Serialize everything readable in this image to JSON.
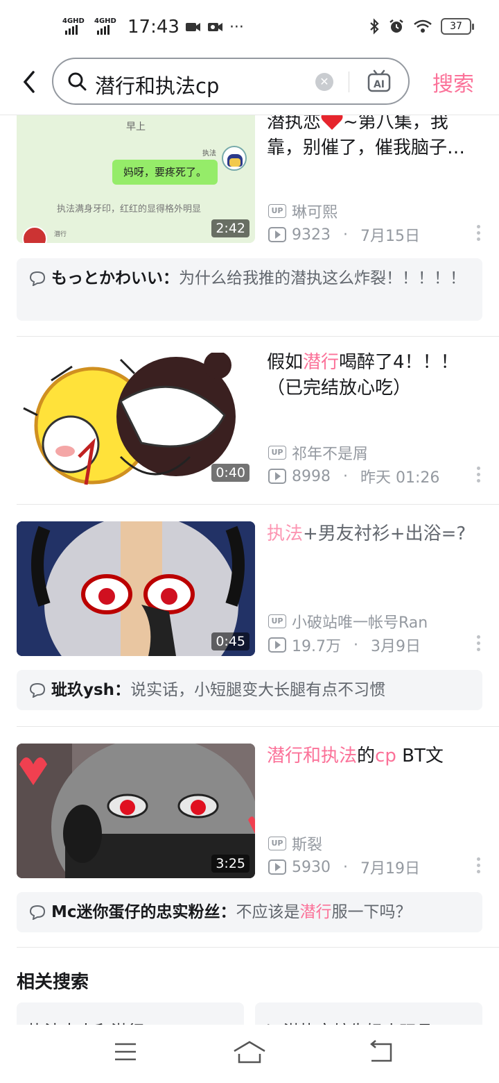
{
  "status_bar": {
    "signal_1_label": "4GHD",
    "signal_2_label": "4GHD",
    "time": "17:43",
    "more": "···",
    "battery": "37"
  },
  "search": {
    "query": "潜行和执法cp",
    "clear_icon": "clear-icon",
    "ai_label": "AI",
    "button_label": "搜索"
  },
  "accent_color": "#fb7299",
  "results": [
    {
      "title_parts": [
        "潜执恋",
        "~第八集，我靠，别催了，催我脑子…"
      ],
      "thumb_texts": [
        "早上",
        "执法",
        "妈呀，要疼死了。",
        "执法满身牙印，红红的显得格外明显",
        "潜行"
      ],
      "duration": "2:42",
      "uploader": "琳可熙",
      "views": "9323",
      "date": "7月15日",
      "comment_user": "もっとかわいい",
      "comment_text": "为什么给我推的潜执这么炸裂！！！！！"
    },
    {
      "title_pre": "假如",
      "title_hl": "潜行",
      "title_post": "喝醉了4！！！（已完结放心吃）",
      "duration": "0:40",
      "uploader": "祁年不是屑",
      "views": "8998",
      "date": "昨天 01:26"
    },
    {
      "title_hl": "执法",
      "title_post": "+男友衬衫+出浴=?",
      "duration": "0:45",
      "uploader": "小破站唯一帐号Ran",
      "views": "19.7万",
      "date": "3月9日",
      "comment_user": "玼玖ysh",
      "comment_text": "说实话，小短腿变大长腿有点不习惯"
    },
    {
      "title_hl1": "潜行和执法",
      "title_mid": "的",
      "title_hl2": "cp",
      "title_post": " BT文",
      "duration": "3:25",
      "uploader": "斯裂",
      "views": "5930",
      "date": "7月19日",
      "comment_user": "Mc迷你蛋仔的忠实粉丝",
      "comment_pre": "不应该是",
      "comment_hl": "潜行",
      "comment_post": "服一下吗？"
    }
  ],
  "related": {
    "title": "相关搜索",
    "items": [
      "执法大人和潜行",
      "bt潜执文较失妈小玩具"
    ]
  },
  "colon": "：",
  "dot_sep": "·",
  "up_label": "UP"
}
